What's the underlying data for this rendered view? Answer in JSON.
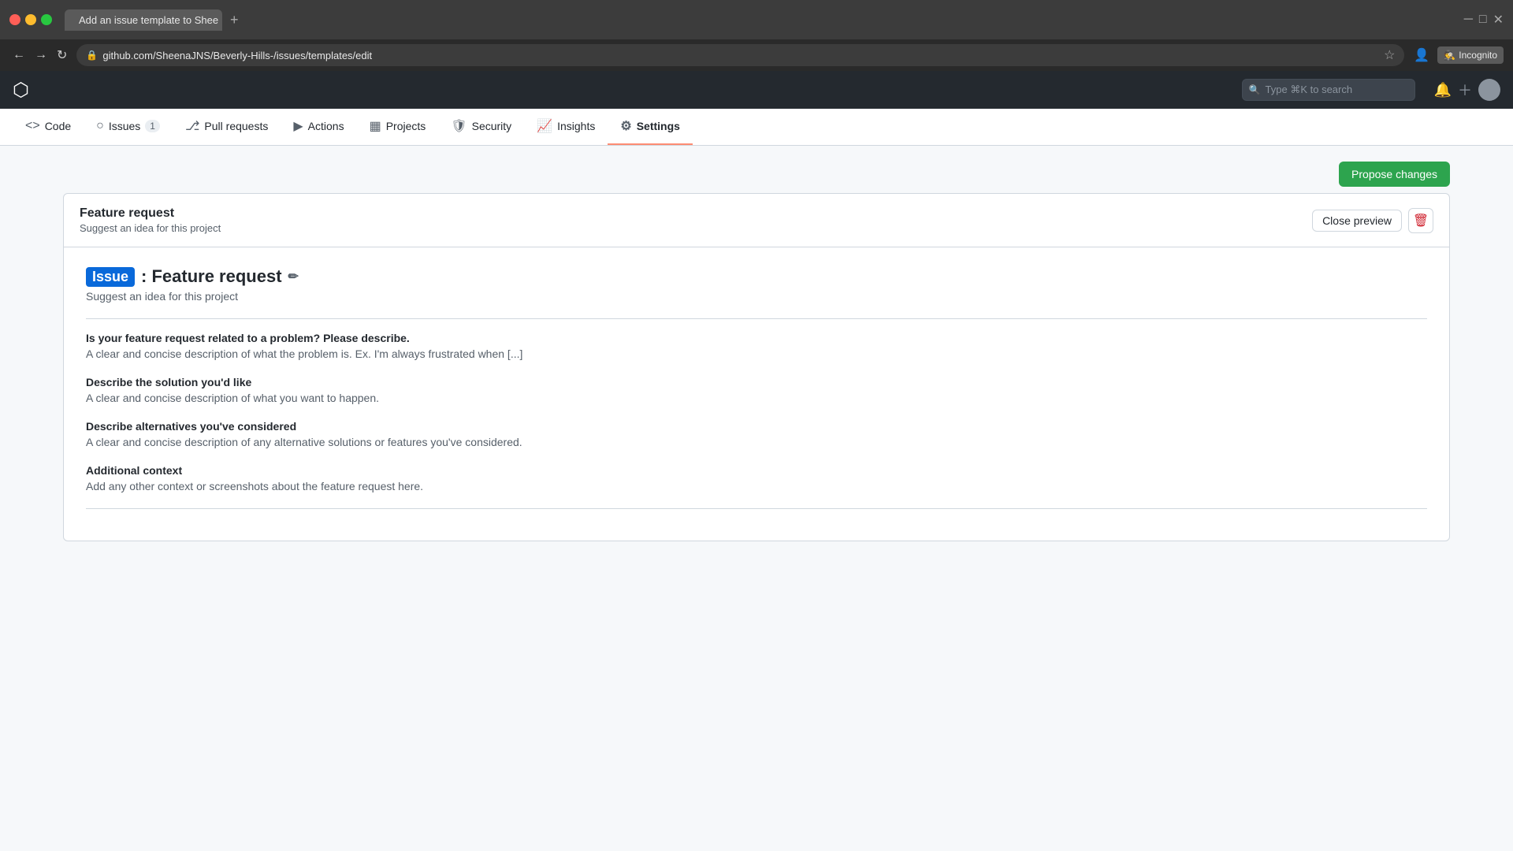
{
  "browser": {
    "tab_title": "Add an issue template to Shee",
    "url": "github.com/SheenaJNS/Beverly-Hills-/issues/templates/edit",
    "new_tab_label": "+",
    "incognito_label": "Incognito"
  },
  "github_header": {
    "logo": "⬡",
    "search_placeholder": "Type ⌘K to search"
  },
  "repo_nav": {
    "items": [
      {
        "id": "code",
        "icon": "<>",
        "label": "Code"
      },
      {
        "id": "issues",
        "icon": "○",
        "label": "Issues",
        "badge": "1"
      },
      {
        "id": "pull-requests",
        "icon": "⎇",
        "label": "Pull requests"
      },
      {
        "id": "actions",
        "icon": "▶",
        "label": "Actions"
      },
      {
        "id": "projects",
        "icon": "▦",
        "label": "Projects"
      },
      {
        "id": "security",
        "icon": "🛡",
        "label": "Security"
      },
      {
        "id": "insights",
        "icon": "📈",
        "label": "Insights"
      },
      {
        "id": "settings",
        "icon": "⚙",
        "label": "Settings",
        "active": true
      }
    ]
  },
  "toolbar": {
    "propose_changes_label": "Propose changes"
  },
  "template_card": {
    "title": "Feature request",
    "subtitle": "Suggest an idea for this project",
    "close_preview_label": "Close preview",
    "delete_icon": "🗑",
    "preview": {
      "issue_label": "Issue",
      "title": ": Feature request",
      "subtitle": "Suggest an idea for this project",
      "sections": [
        {
          "heading": "Is your feature request related to a problem? Please describe.",
          "body": "A clear and concise description of what the problem is. Ex. I'm always frustrated when [...]"
        },
        {
          "heading": "Describe the solution you'd like",
          "body": "A clear and concise description of what you want to happen."
        },
        {
          "heading": "Describe alternatives you've considered",
          "body": "A clear and concise description of any alternative solutions or features you've considered."
        },
        {
          "heading": "Additional context",
          "body": "Add any other context or screenshots about the feature request here."
        }
      ]
    }
  }
}
